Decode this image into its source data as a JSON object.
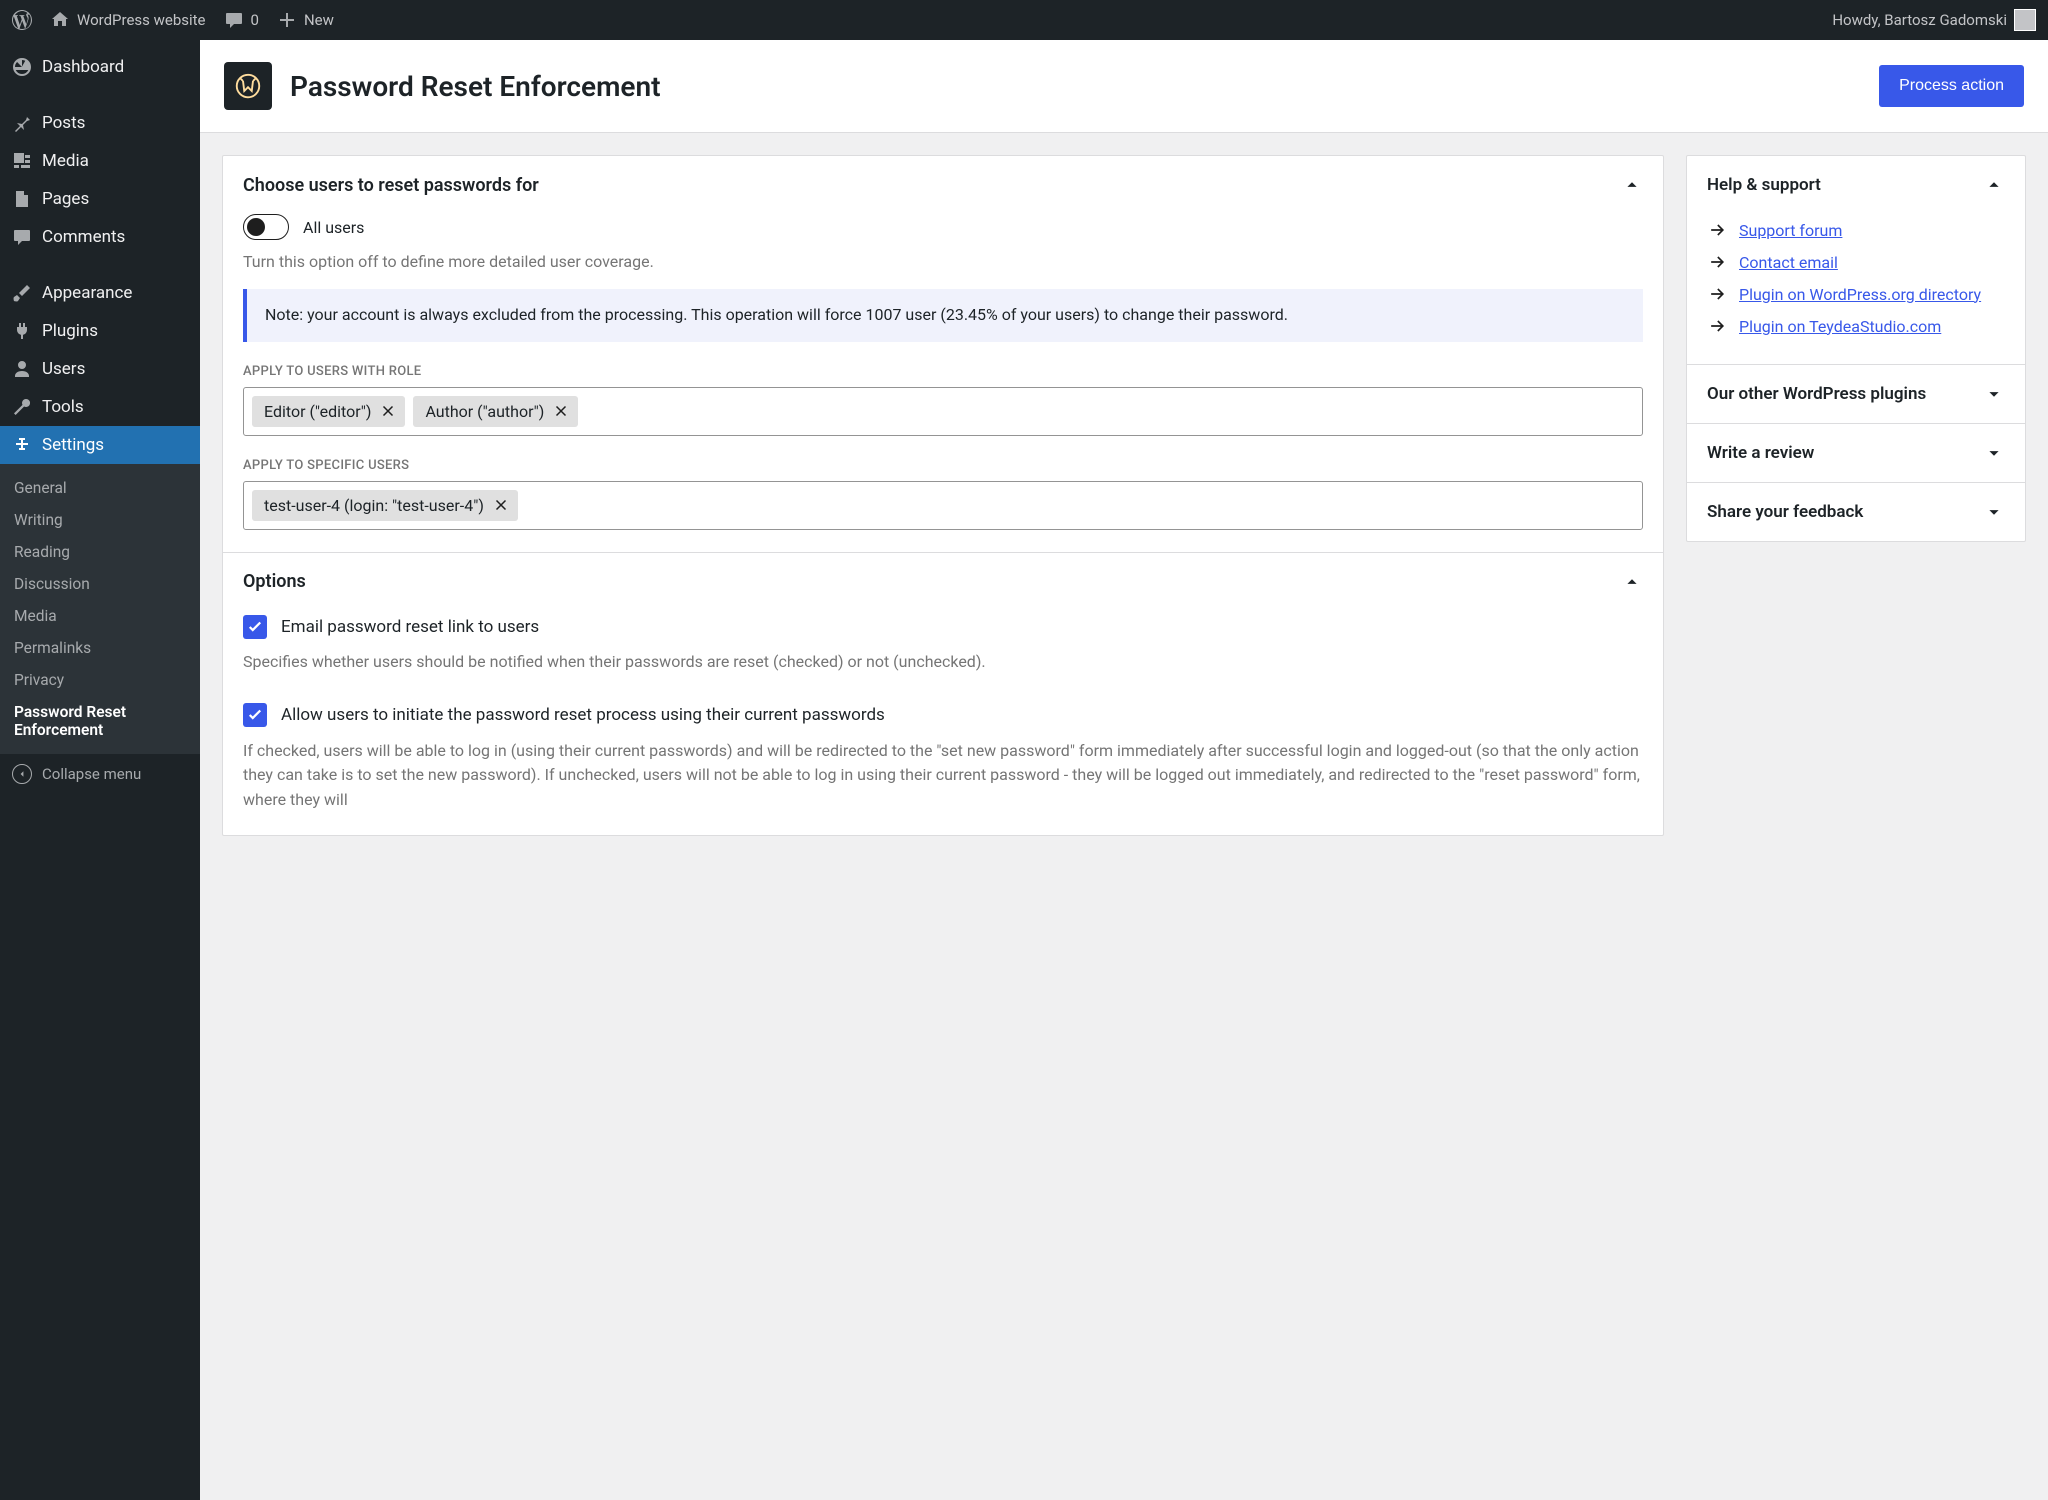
{
  "adminbar": {
    "site_name": "WordPress website",
    "comments_count": "0",
    "new_label": "New",
    "howdy": "Howdy, Bartosz Gadomski"
  },
  "sidebar": {
    "items": [
      {
        "label": "Dashboard"
      },
      {
        "label": "Posts"
      },
      {
        "label": "Media"
      },
      {
        "label": "Pages"
      },
      {
        "label": "Comments"
      },
      {
        "label": "Appearance"
      },
      {
        "label": "Plugins"
      },
      {
        "label": "Users"
      },
      {
        "label": "Tools"
      },
      {
        "label": "Settings"
      }
    ],
    "submenu": [
      {
        "label": "General"
      },
      {
        "label": "Writing"
      },
      {
        "label": "Reading"
      },
      {
        "label": "Discussion"
      },
      {
        "label": "Media"
      },
      {
        "label": "Permalinks"
      },
      {
        "label": "Privacy"
      },
      {
        "label": "Password Reset Enforcement"
      }
    ],
    "collapse": "Collapse menu"
  },
  "header": {
    "title": "Password Reset Enforcement",
    "process_button": "Process action"
  },
  "choose_panel": {
    "title": "Choose users to reset passwords for",
    "all_users_label": "All users",
    "all_users_help": "Turn this option off to define more detailed user coverage.",
    "notice": "Note: your account is always excluded from the processing. This operation will force 1007 user (23.45% of your users) to change their password.",
    "roles_label": "Apply to users with role",
    "roles_tokens": [
      "Editor (\"editor\")",
      "Author (\"author\")"
    ],
    "users_label": "Apply to specific users",
    "users_tokens": [
      "test-user-4 (login: \"test-user-4\")"
    ]
  },
  "options_panel": {
    "title": "Options",
    "opt1_label": "Email password reset link to users",
    "opt1_desc": "Specifies whether users should be notified when their passwords are reset (checked) or not (unchecked).",
    "opt2_label": "Allow users to initiate the password reset process using their current passwords",
    "opt2_desc": "If checked, users will be able to log in (using their current passwords) and will be redirected to the \"set new password\" form immediately after successful login and logged-out (so that the only action they can take is to set the new password). If unchecked, users will not be able to log in using their current password - they will be logged out immediately, and redirected to the \"reset password\" form, where they will"
  },
  "help_panel": {
    "title": "Help & support",
    "links": [
      "Support forum",
      "Contact email",
      "Plugin on WordPress.org directory",
      "Plugin on TeydeaStudio.com"
    ],
    "sections": [
      "Our other WordPress plugins",
      "Write a review",
      "Share your feedback"
    ]
  }
}
